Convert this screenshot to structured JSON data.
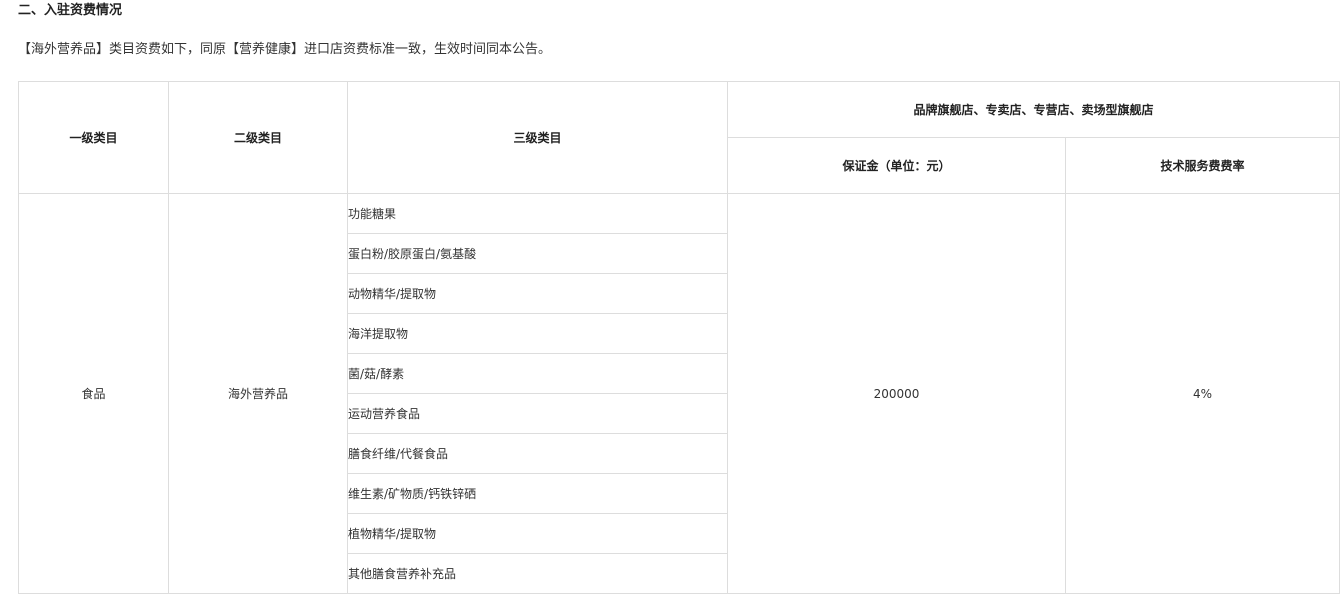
{
  "section_title": "二、入驻资费情况",
  "intro_text": "【海外营养品】类目资费如下，同原【营养健康】进口店资费标准一致，生效时间同本公告。",
  "table": {
    "headers": {
      "level1": "一级类目",
      "level2": "二级类目",
      "level3": "三级类目",
      "store_types": "品牌旗舰店、专卖店、专营店、卖场型旗舰店",
      "deposit": "保证金（单位：元）",
      "service_rate": "技术服务费费率"
    },
    "row": {
      "level1": "食品",
      "level2": "海外营养品",
      "deposit": "200000",
      "service_rate": "4%",
      "level3_items": [
        "功能糖果",
        "蛋白粉/胶原蛋白/氨基酸",
        "动物精华/提取物",
        "海洋提取物",
        "菌/菇/酵素",
        "运动营养食品",
        "膳食纤维/代餐食品",
        "维生素/矿物质/钙铁锌硒",
        "植物精华/提取物",
        "其他膳食营养补充品"
      ]
    }
  }
}
